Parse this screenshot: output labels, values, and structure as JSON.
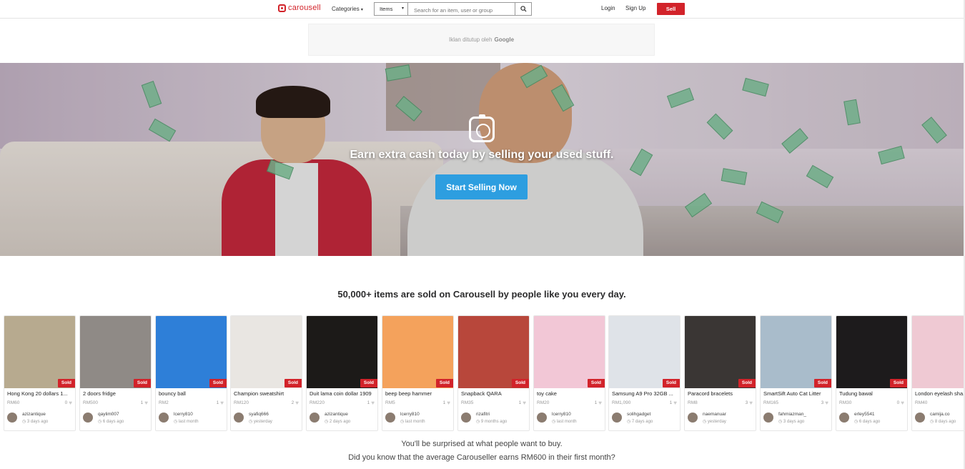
{
  "header": {
    "logo_text": "carousell",
    "categories_label": "Categories",
    "search_scope": "Items",
    "search_placeholder": "Search for an item, user or group",
    "login_label": "Login",
    "signup_label": "Sign Up",
    "sell_label": "Sell",
    "brand_color": "#d2232a"
  },
  "ad": {
    "text": "Iklan ditutup oleh",
    "brand": "Google"
  },
  "hero": {
    "title": "Earn extra cash today by selling your used stuff.",
    "cta_label": "Start Selling Now",
    "cta_color": "#2d9ee0"
  },
  "section": {
    "headline": "50,000+ items are sold on Carousell by people like you every day."
  },
  "listings": [
    {
      "title": "Hong Kong 20 dollars 1...",
      "price": "RM60",
      "likes": "0",
      "user": "azizantique",
      "time": "3 days ago",
      "badge": "Sold",
      "photo": "#b7aa8f"
    },
    {
      "title": "2 doors fridge",
      "price": "RM500",
      "likes": "1",
      "user": "qaylim007",
      "time": "6 days ago",
      "badge": "Sold",
      "photo": "#8f8a86"
    },
    {
      "title": "bouncy ball",
      "price": "RM2",
      "likes": "1",
      "user": "lcerry810",
      "time": "last month",
      "badge": "Sold",
      "photo": "#2e7fd8"
    },
    {
      "title": "Champion sweatshirt",
      "price": "RM120",
      "likes": "2",
      "user": "syafiq666",
      "time": "yesterday",
      "badge": "Sold",
      "photo": "#e9e6e2"
    },
    {
      "title": "Duit lama coin dollar 1909",
      "price": "RM220",
      "likes": "1",
      "user": "azizantique",
      "time": "2 days ago",
      "badge": "Sold",
      "photo": "#1c1a18"
    },
    {
      "title": "beep beep hammer",
      "price": "RM5",
      "likes": "1",
      "user": "lcerry810",
      "time": "last month",
      "badge": "Sold",
      "photo": "#f4a25c"
    },
    {
      "title": "Snapback QARA",
      "price": "RM35",
      "likes": "1",
      "user": "rizafitri",
      "time": "9 months ago",
      "badge": "Sold",
      "photo": "#b8473b"
    },
    {
      "title": "toy cake",
      "price": "RM20",
      "likes": "1",
      "user": "lcerry810",
      "time": "last month",
      "badge": "Sold",
      "photo": "#f2c7d6"
    },
    {
      "title": "Samsung A9 Pro 32GB ...",
      "price": "RM1,090",
      "likes": "1",
      "user": "solihgadget",
      "time": "7 days ago",
      "badge": "Sold",
      "photo": "#dfe3e8"
    },
    {
      "title": "Paracord bracelets",
      "price": "RM8",
      "likes": "3",
      "user": "naemanuar",
      "time": "yesterday",
      "badge": "Sold",
      "photo": "#3a3634"
    },
    {
      "title": "SmartSift Auto Cat Litter",
      "price": "RM165",
      "likes": "3",
      "user": "fahmiazman_",
      "time": "3 days ago",
      "badge": "Sold",
      "photo": "#a9bccb"
    },
    {
      "title": "Tudung bawal",
      "price": "RM30",
      "likes": "0",
      "user": "erley5541",
      "time": "6 days ago",
      "badge": "Sold",
      "photo": "#1d1b1c"
    },
    {
      "title": "London eyelash sha...",
      "price": "RM40",
      "likes": "",
      "user": "camija.co",
      "time": "8 days ago",
      "badge": "",
      "photo": "#efc9d3"
    }
  ],
  "footer": {
    "line1": "You'll be surprised at what people want to buy.",
    "line2": "Did you know that the average Carouseller earns RM600 in their first month?"
  }
}
